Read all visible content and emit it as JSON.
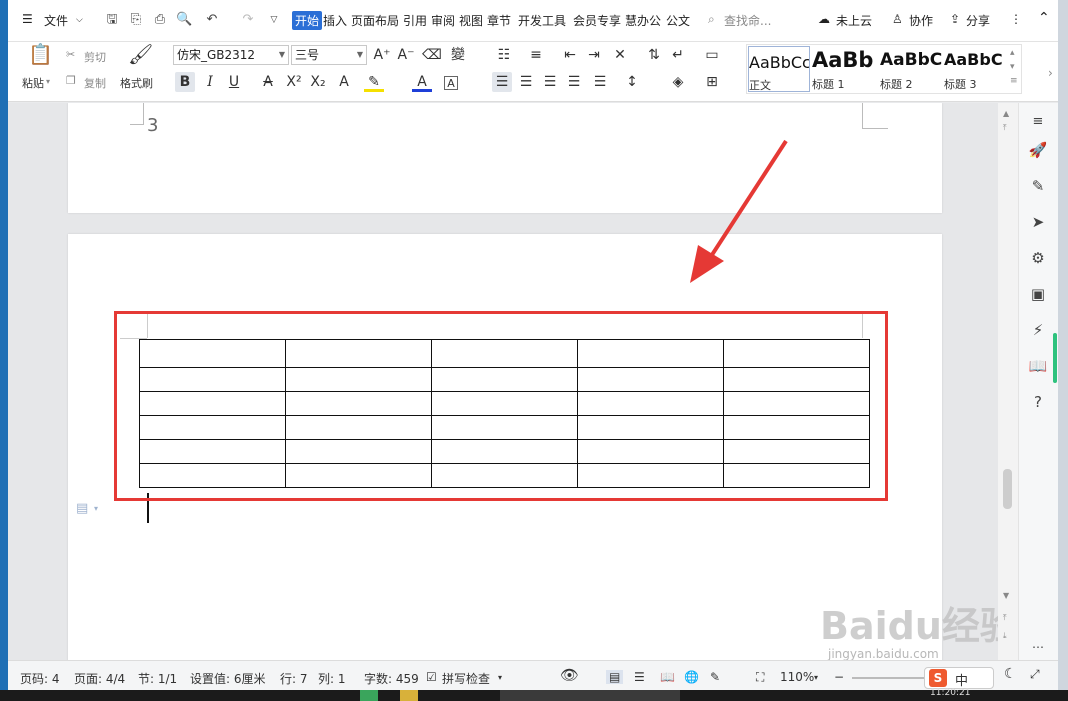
{
  "menubar": {
    "file_label": "文件",
    "tabs": [
      "开始",
      "插入",
      "页面布局",
      "引用",
      "审阅",
      "视图",
      "章节",
      "开发工具",
      "会员专享",
      "慧办公",
      "公文"
    ],
    "search_label": "查找命...",
    "cloud_label": "未上云",
    "collab_label": "协作",
    "share_label": "分享"
  },
  "ribbon": {
    "paste_label": "粘贴",
    "cut_label": "剪切",
    "copy_label": "复制",
    "format_painter_label": "格式刷",
    "font_name": "仿宋_GB2312",
    "font_size": "三号",
    "styles": [
      {
        "sample": "AaBbCcDd",
        "name": "正文"
      },
      {
        "sample": "AaBb",
        "name": "标题 1"
      },
      {
        "sample": "AaBbC",
        "name": "标题 2"
      },
      {
        "sample": "AaBbC",
        "name": "标题 3"
      }
    ]
  },
  "document": {
    "page_number_text": "3",
    "table_rows": 6,
    "table_cols": 5
  },
  "annotation": {
    "highlight_color": "#e53935",
    "arrow_color": "#e53935"
  },
  "statusbar": {
    "page_code": "页码: 4",
    "pages": "页面: 4/4",
    "section": "节: 1/1",
    "setting": "设置值: 6厘米",
    "row": "行: 7",
    "col": "列: 1",
    "word_count": "字数: 459",
    "spell_check": "拼写检查",
    "zoom": "110%"
  },
  "watermark": {
    "text": "Baidu经验",
    "url": "jingyan.baidu.com"
  },
  "taskbar": {
    "clock": "11:20:21"
  }
}
